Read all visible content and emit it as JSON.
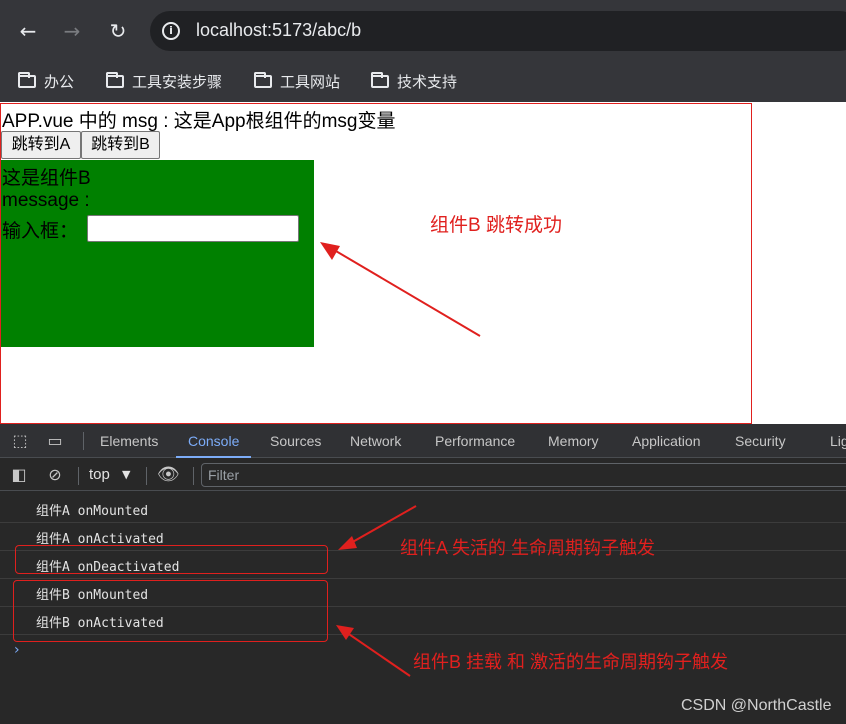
{
  "browser": {
    "url": "localhost:5173/abc/b",
    "bookmarks": [
      "办公",
      "工具安装步骤",
      "工具网站",
      "技术支持"
    ]
  },
  "page": {
    "app_msg": "APP.vue 中的 msg : 这是App根组件的msg变量",
    "button_a": "跳转到A",
    "button_b": "跳转到B",
    "component_b": {
      "title": "这是组件B",
      "message_label": "message :",
      "input_label": "输入框：",
      "input_value": "",
      "background_color": "#008000"
    }
  },
  "annotations": {
    "page_note": "组件B 跳转成功",
    "console_note_a": "组件A  失活的 生命周期钩子触发",
    "console_note_b": "组件B 挂载 和 激活的生命周期钩子触发",
    "color": "#e0201e"
  },
  "devtools": {
    "tabs": [
      "Elements",
      "Console",
      "Sources",
      "Network",
      "Performance",
      "Memory",
      "Application",
      "Security",
      "Lig"
    ],
    "active_tab": "Console",
    "context": "top",
    "filter_placeholder": "Filter",
    "logs": [
      "组件A onMounted",
      "组件A onActivated",
      "组件A onDeactivated",
      "组件B onMounted",
      "组件B onActivated"
    ]
  },
  "watermark": "CSDN @NorthCastle"
}
